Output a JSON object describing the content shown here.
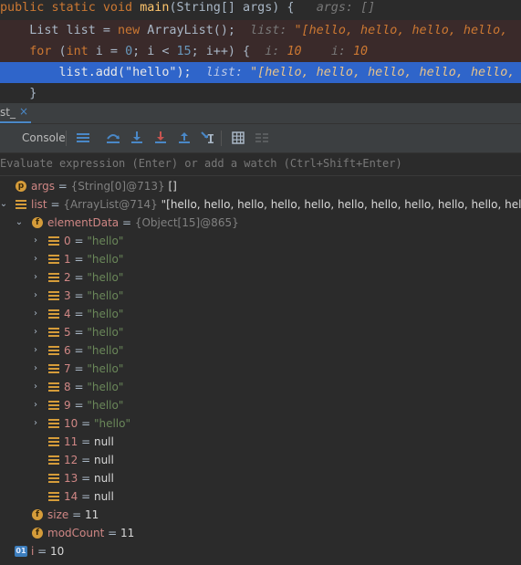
{
  "code": {
    "line1": {
      "pub": "public",
      "st": "static",
      "vd": "void",
      "method": "main",
      "params": "(String[] args) {",
      "hint_label": "args:",
      "hint_value": "[]"
    },
    "line2": {
      "decl": "List list = ",
      "new_kw": "new",
      "ctor": " ArrayList();",
      "hint_label": "list:",
      "hint_value": "\"[hello, hello, hello, hello,"
    },
    "line3": {
      "for_kw": "for",
      "open": " (",
      "int_kw": "int",
      "init": " i = ",
      "zero": "0",
      "cond": "; i < ",
      "fifteen": "15",
      "incr": "; i++) {",
      "hint1_label": "i:",
      "hint1_value": "10",
      "hint2_label": "i:",
      "hint2_value": "10"
    },
    "line4": {
      "call": "list.add(",
      "arg": "\"hello\"",
      "close": ");",
      "hint_label": "list:",
      "hint_value": "\"[hello, hello, hello, hello, hello,"
    },
    "line5": {
      "brace": "}"
    }
  },
  "panel": {
    "tab_title": "st_",
    "tab_close": "×",
    "console_label": "Console",
    "eval_placeholder": "Evaluate expression (Enter) or add a watch (Ctrl+Shift+Enter)"
  },
  "toolbar_icons": [
    "menu-icon",
    "step-over-icon",
    "step-into-icon",
    "force-step-into-icon",
    "step-out-icon",
    "run-to-cursor-icon",
    "evaluate-icon",
    "trace-icon"
  ],
  "variables": {
    "args": {
      "icon": "p",
      "name": "args",
      "eq": " = ",
      "type": "{String[0]@713}",
      "value": " []"
    },
    "list": {
      "name": "list",
      "eq": " = ",
      "type": "{ArrayList@714}",
      "value": " \"[hello, hello, hello, hello, hello, hello, hello, hello, hello, hello, hello]\""
    },
    "elementData": {
      "icon": "f",
      "name": "elementData",
      "eq": " = ",
      "type": "{Object[15]@865}"
    },
    "items": [
      {
        "name": "0",
        "eq": " = ",
        "value": "\"hello\""
      },
      {
        "name": "1",
        "eq": " = ",
        "value": "\"hello\""
      },
      {
        "name": "2",
        "eq": " = ",
        "value": "\"hello\""
      },
      {
        "name": "3",
        "eq": " = ",
        "value": "\"hello\""
      },
      {
        "name": "4",
        "eq": " = ",
        "value": "\"hello\""
      },
      {
        "name": "5",
        "eq": " = ",
        "value": "\"hello\""
      },
      {
        "name": "6",
        "eq": " = ",
        "value": "\"hello\""
      },
      {
        "name": "7",
        "eq": " = ",
        "value": "\"hello\""
      },
      {
        "name": "8",
        "eq": " = ",
        "value": "\"hello\""
      },
      {
        "name": "9",
        "eq": " = ",
        "value": "\"hello\""
      },
      {
        "name": "10",
        "eq": " = ",
        "value": "\"hello\""
      },
      {
        "name": "11",
        "eq": " = ",
        "value": "null"
      },
      {
        "name": "12",
        "eq": " = ",
        "value": "null"
      },
      {
        "name": "13",
        "eq": " = ",
        "value": "null"
      },
      {
        "name": "14",
        "eq": " = ",
        "value": "null"
      }
    ],
    "size": {
      "icon": "f",
      "name": "size",
      "eq": " = ",
      "value": "11"
    },
    "modCount": {
      "icon": "f",
      "name": "modCount",
      "eq": " = ",
      "value": "11"
    },
    "i": {
      "icon": "01",
      "name": "i",
      "eq": " = ",
      "value": "10"
    }
  },
  "colors": {
    "keyword": "#cc7832",
    "method": "#ffc66d",
    "string": "#6a8759",
    "number": "#6897bb",
    "highlight": "#2f65ca",
    "field_icon": "#d59c3a",
    "var_name": "#d08785"
  }
}
